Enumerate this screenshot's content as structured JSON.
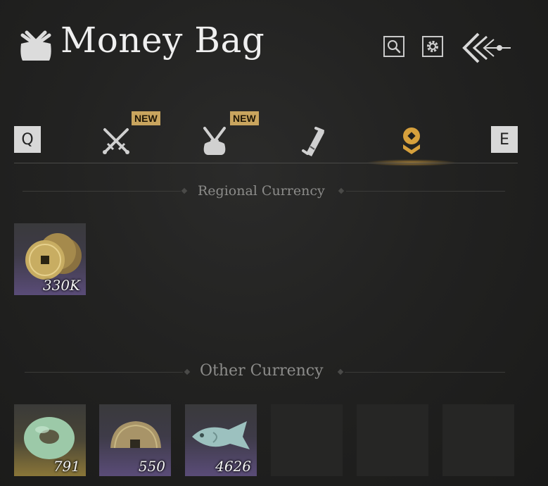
{
  "header": {
    "title": "Money Bag",
    "icons": [
      "money-bag-icon",
      "search-icon",
      "gear-icon",
      "back-arrow-icon"
    ]
  },
  "tabs": {
    "prev_key": "Q",
    "next_key": "E",
    "items": [
      {
        "name": "weapons",
        "icon": "crossed-swords-icon",
        "badge": "NEW"
      },
      {
        "name": "bag",
        "icon": "bundle-bag-icon",
        "badge": "NEW"
      },
      {
        "name": "scroll",
        "icon": "scroll-icon",
        "badge": ""
      },
      {
        "name": "currency",
        "icon": "coin-stack-icon",
        "badge": "",
        "active": true
      }
    ],
    "accent_color": "#d6a03c"
  },
  "sections": {
    "regional": {
      "title": "Regional Currency",
      "items": [
        {
          "icon": "copper-coins-icon",
          "quantity": "330K"
        }
      ]
    },
    "other": {
      "title": "Other Currency",
      "items": [
        {
          "icon": "jade-ring-icon",
          "quantity": "791"
        },
        {
          "icon": "bronze-half-coin-icon",
          "quantity": "550"
        },
        {
          "icon": "jade-fish-icon",
          "quantity": "4626"
        }
      ],
      "empty_slots": 3
    }
  }
}
